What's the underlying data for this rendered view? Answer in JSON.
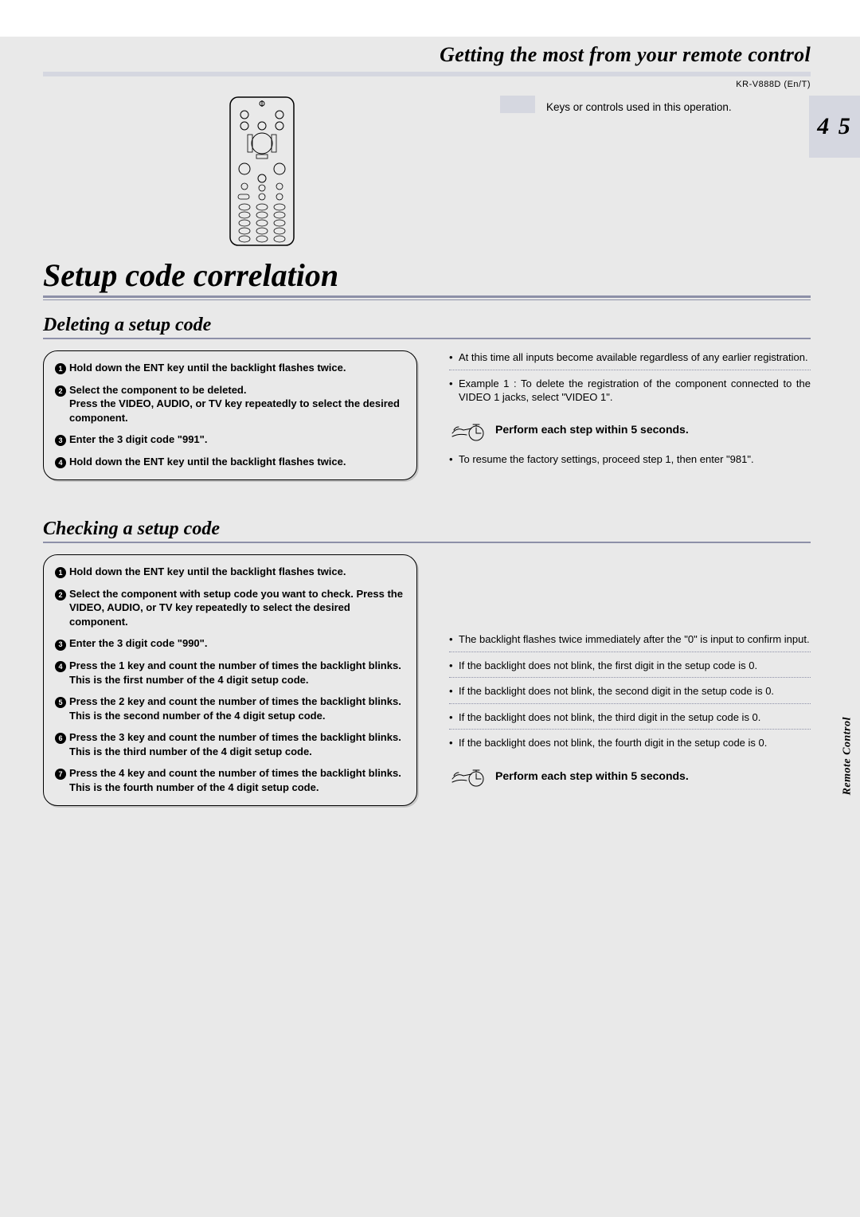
{
  "header": {
    "title": "Getting the most from your remote control",
    "model": "KR-V888D (En/T)",
    "page_number": "4 5"
  },
  "keys_caption": "Keys or controls used in this operation.",
  "main_title": "Setup code correlation",
  "spine_label": "Remote Control",
  "sections": {
    "deleting": {
      "title": "Deleting a setup code",
      "steps": [
        "Hold down the ENT key until the backlight flashes twice.",
        "Select the component to be deleted.\nPress the VIDEO, AUDIO, or TV key repeatedly to select the desired component.",
        "Enter the 3 digit code \"991\".",
        "Hold down the ENT key until the backlight flashes twice."
      ],
      "notes": [
        "At this time all inputs become available regardless of any earlier registration.",
        "Example 1 : To delete the registration of the component connected to the VIDEO 1 jacks, select \"VIDEO 1\"."
      ],
      "tip": "Perform each step within 5 seconds.",
      "post_tip": "To resume the factory settings, proceed step 1, then enter \"981\"."
    },
    "checking": {
      "title": "Checking a setup code",
      "steps": [
        "Hold down the ENT key until the backlight flashes twice.",
        "Select the component with setup code you want to check. Press the VIDEO, AUDIO, or TV key repeatedly to select the desired component.",
        "Enter the 3 digit code \"990\".",
        "Press the 1 key and count the number of times the backlight blinks. This is the first number of the 4 digit setup code.",
        "Press the 2 key and count the number of times the backlight blinks. This is the second number of the 4 digit setup code.",
        "Press the 3 key and count the number of times the backlight blinks. This is the third number of the 4 digit setup code.",
        "Press the 4 key and count the number of times the backlight blinks. This is the fourth number of the 4 digit setup code."
      ],
      "notes": [
        "The backlight flashes twice immediately after the \"0\" is input to confirm input.",
        "If the backlight does not blink, the first digit in the setup code is 0.",
        "If the backlight does not blink, the second digit in the setup code is 0.",
        "If the backlight does not blink, the third digit in the setup code is 0.",
        "If the backlight does not blink, the fourth digit in the setup code is 0."
      ],
      "tip": "Perform each step within 5 seconds."
    }
  }
}
